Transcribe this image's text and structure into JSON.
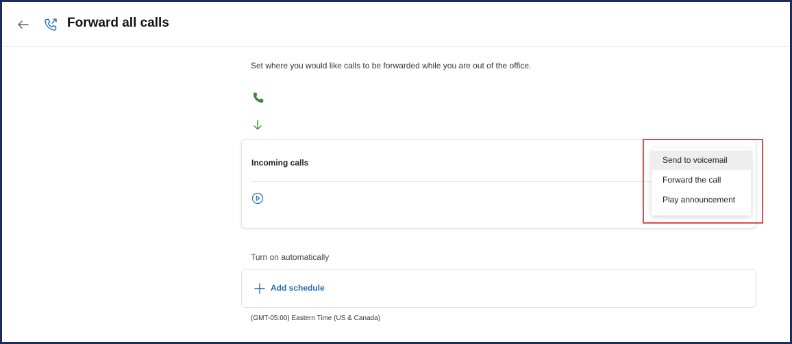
{
  "header": {
    "title": "Forward all calls",
    "back_icon": "arrow-left-icon",
    "title_icon": "phone-forward-icon"
  },
  "intro": {
    "text": "Set where you would like calls to be forwarded while you are out of the office."
  },
  "flow": {
    "phone_icon": "phone-icon",
    "phone_color": "#3a8a3a",
    "arrow_icon": "arrow-down-icon"
  },
  "incoming_card": {
    "label": "Incoming calls",
    "play_icon": "play-circle-icon",
    "accent_color": "#1f6dab"
  },
  "dropdown_menu": {
    "highlight_color": "#e04a4a",
    "items": [
      {
        "label": "Send to voicemail",
        "selected": true
      },
      {
        "label": "Forward the call",
        "selected": false
      },
      {
        "label": "Play announcement",
        "selected": false
      }
    ]
  },
  "schedule": {
    "section_label": "Turn on automatically",
    "add_label": "Add schedule",
    "add_icon": "plus-icon",
    "timezone": "(GMT-05:00) Eastern Time (US & Canada)"
  }
}
